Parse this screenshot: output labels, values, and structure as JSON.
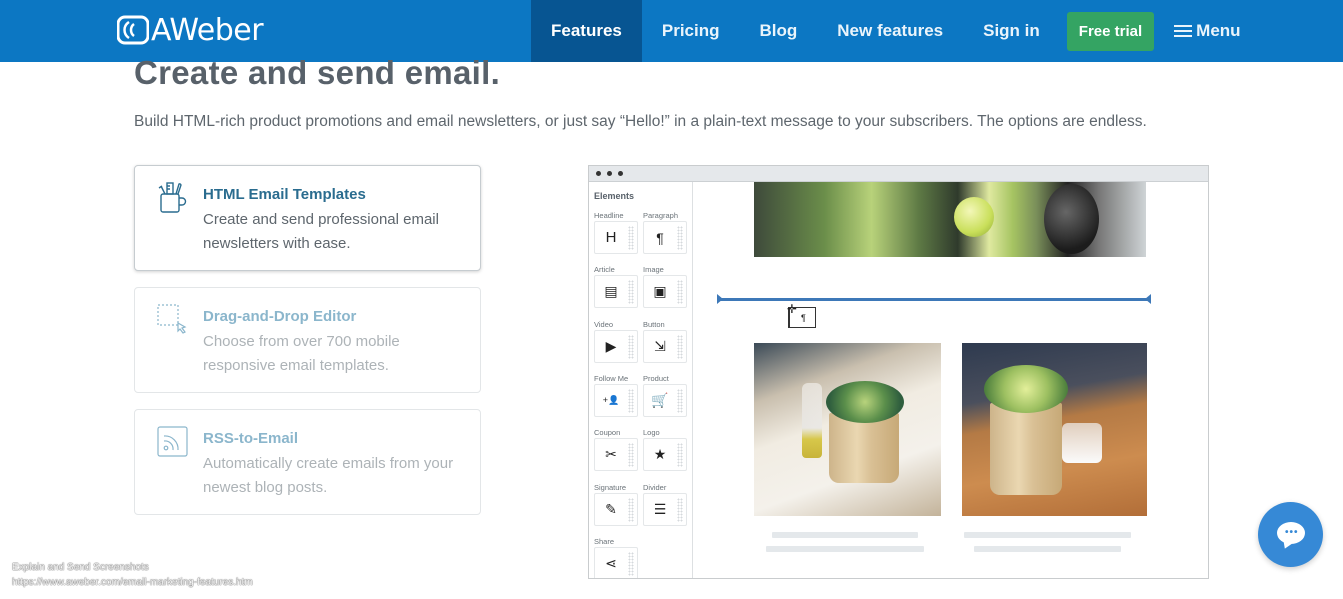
{
  "header": {
    "logo_text": "AWeber",
    "nav": [
      {
        "label": "Features",
        "active": true
      },
      {
        "label": "Pricing"
      },
      {
        "label": "Blog"
      },
      {
        "label": "New features"
      },
      {
        "label": "Sign in"
      }
    ],
    "cta_label": "Free trial",
    "menu_label": "Menu",
    "colors": {
      "bar": "#0c77c3",
      "active": "#075592",
      "cta": "#34a463"
    }
  },
  "hero": {
    "title": "Create and send email.",
    "subtitle": "Build HTML-rich product promotions and email newsletters, or just say “Hello!” in a plain-text message to your subscribers. The options are endless."
  },
  "features": [
    {
      "icon": "pencil-cup-icon",
      "title": "HTML Email Templates",
      "desc": "Create and send professional email newsletters with ease.",
      "active": true
    },
    {
      "icon": "drag-select-icon",
      "title": "Drag-and-Drop Editor",
      "desc": "Choose from over 700 mobile responsive email templates.",
      "active": false
    },
    {
      "icon": "rss-icon",
      "title": "RSS-to-Email",
      "desc": "Automatically create emails from your newest blog posts.",
      "active": false
    }
  ],
  "editor": {
    "sidebar_title": "Elements",
    "elements": [
      {
        "label": "Headline",
        "glyph": "H"
      },
      {
        "label": "Paragraph",
        "glyph": "¶"
      },
      {
        "label": "Article",
        "glyph": "▤"
      },
      {
        "label": "Image",
        "glyph": "▣"
      },
      {
        "label": "Video",
        "glyph": "▶"
      },
      {
        "label": "Button",
        "glyph": "⇲"
      },
      {
        "label": "Follow Me",
        "glyph": "+👤"
      },
      {
        "label": "Product",
        "glyph": "🛒"
      },
      {
        "label": "Coupon",
        "glyph": "✂"
      },
      {
        "label": "Logo",
        "glyph": "★"
      },
      {
        "label": "Signature",
        "glyph": "✎"
      },
      {
        "label": "Divider",
        "glyph": "☰"
      },
      {
        "label": "Share",
        "glyph": "⋖"
      }
    ],
    "drag_ghost_glyph": "¶",
    "drag_cross_glyph": "✛"
  },
  "chat": {
    "dots": "•••"
  },
  "overlay": {
    "line1": "Explain and Send Screenshots",
    "line2": "https://www.aweber.com/email-marketing-features.htm"
  }
}
